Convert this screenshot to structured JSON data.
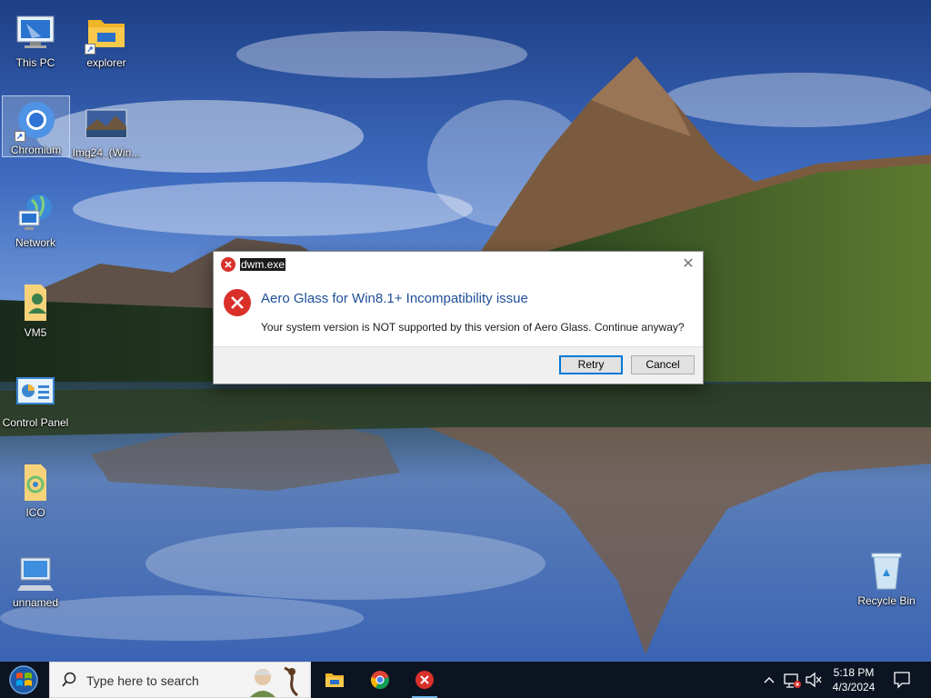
{
  "desktop": {
    "icons": [
      {
        "label": "This PC",
        "icon": "this-pc-icon"
      },
      {
        "label": "explorer",
        "icon": "folder-shortcut-icon"
      },
      {
        "label": "Chromium",
        "icon": "chromium-icon"
      },
      {
        "label": "Img24_(Win...",
        "icon": "image-thumbnail-icon"
      },
      {
        "label": "Network",
        "icon": "network-icon"
      },
      {
        "label": "VM5",
        "icon": "user-folder-icon"
      },
      {
        "label": "Control Panel",
        "icon": "control-panel-icon"
      },
      {
        "label": "ICO",
        "icon": "ico-folder-icon"
      },
      {
        "label": "unnamed",
        "icon": "computer-icon"
      },
      {
        "label": "Recycle Bin",
        "icon": "recycle-bin-icon"
      }
    ],
    "selected_icon": "Chromium"
  },
  "dialog": {
    "title": "dwm.exe",
    "heading": "Aero Glass for Win8.1+ Incompatibility issue",
    "message": "Your system version is NOT supported by this version of Aero Glass. Continue anyway?",
    "retry_label": "Retry",
    "cancel_label": "Cancel",
    "close_glyph": "✕",
    "error_color": "#d9302a",
    "heading_color": "#1f4e99"
  },
  "taskbar": {
    "search_placeholder": "Type here to search",
    "apps": [
      "File Explorer",
      "Chromium",
      "Error dialog"
    ],
    "clock_time": "5:18 PM",
    "clock_date": "4/3/2024",
    "accent": "#76b9ed"
  }
}
